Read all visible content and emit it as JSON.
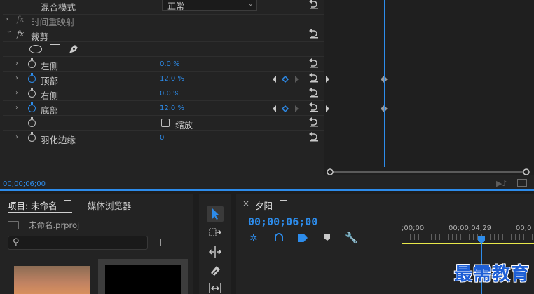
{
  "effect_controls": {
    "blend_row": {
      "label": "混合模式",
      "value": "正常"
    },
    "time_remap": {
      "label": "时间重映射"
    },
    "crop": {
      "label": "裁剪",
      "properties": [
        {
          "label": "左侧",
          "value": "0.0 %"
        },
        {
          "label": "顶部",
          "value": "12.0 %"
        },
        {
          "label": "右侧",
          "value": "0.0 %"
        },
        {
          "label": "底部",
          "value": "12.0 %"
        },
        {
          "label": "缩放",
          "value": ""
        },
        {
          "label": "羽化边缘",
          "value": "0"
        }
      ]
    },
    "timecode": "00;00;06;00"
  },
  "project": {
    "tab_label": "项目: 未命名",
    "media_browser_label": "媒体浏览器",
    "file_name": "未命名.prproj",
    "search_placeholder": ""
  },
  "sequence": {
    "tab_label": "夕阳",
    "close_label": "×",
    "timecode": "00;00;06;00",
    "ruler_labels": [
      ";00;00",
      "00;00;04;29",
      "00;0"
    ]
  },
  "watermark": "最需教育",
  "colors": {
    "accent": "#2d8ceb",
    "panel": "#232323",
    "playhead_line": "#e8e84a"
  }
}
